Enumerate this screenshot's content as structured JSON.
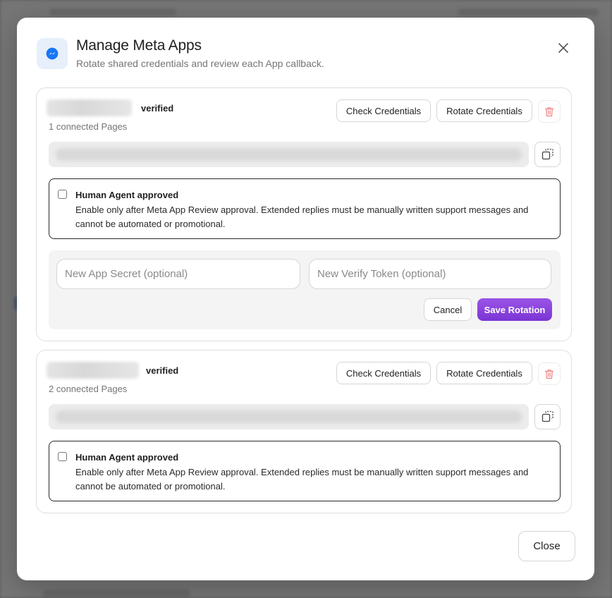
{
  "modal": {
    "title": "Manage Meta Apps",
    "subtitle": "Rotate shared credentials and review each App callback.",
    "close_button_label": "Close"
  },
  "apps": [
    {
      "status": "verified",
      "pages_count": "1 connected Pages",
      "check_credentials_label": "Check Credentials",
      "rotate_credentials_label": "Rotate Credentials",
      "human_agent": {
        "title": "Human Agent approved",
        "description": "Enable only after Meta App Review approval. Extended replies must be manually written support messages and cannot be automated or promotional.",
        "checked": false
      },
      "rotation": {
        "secret_placeholder": "New App Secret (optional)",
        "token_placeholder": "New Verify Token (optional)",
        "cancel_label": "Cancel",
        "save_label": "Save Rotation"
      }
    },
    {
      "status": "verified",
      "pages_count": "2 connected Pages",
      "check_credentials_label": "Check Credentials",
      "rotate_credentials_label": "Rotate Credentials",
      "human_agent": {
        "title": "Human Agent approved",
        "description": "Enable only after Meta App Review approval. Extended replies must be manually written support messages and cannot be automated or promotional.",
        "checked": false
      }
    }
  ],
  "icons": {
    "header": "messenger-icon",
    "close": "close-icon",
    "delete": "trash-icon",
    "copy": "copy-icon"
  },
  "colors": {
    "accent": "#8a45dd",
    "messenger_blue": "#1877f2",
    "delete_red": "#f08080"
  }
}
